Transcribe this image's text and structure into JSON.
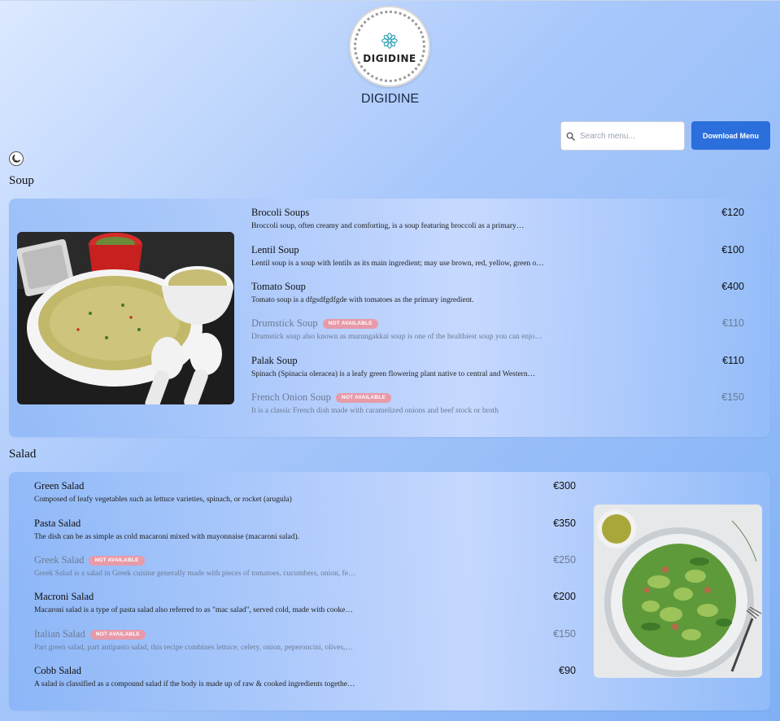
{
  "brand": {
    "name": "DIGIDINE",
    "logo_text": "DIGIDINE"
  },
  "header": {
    "search_placeholder": "Search menu...",
    "download_label": "Download Menu"
  },
  "colors": {
    "accent": "#2a6fdb",
    "badge": "#e79aa8"
  },
  "icons": {
    "search": "search-icon",
    "theme": "moon-icon",
    "logo": "lotus-icon"
  },
  "sections": [
    {
      "title": "Soup",
      "items": [
        {
          "name": "Brocoli Soups",
          "desc": "Broccoli soup, often creamy and comforting, is a soup featuring broccoli as a primary…",
          "price": "€120",
          "available": true,
          "badge": ""
        },
        {
          "name": "Lentil Soup",
          "desc": "Lentil soup is a soup with lentils as its main ingredient; may use brown, red, yellow, green o…",
          "price": "€100",
          "available": true,
          "badge": ""
        },
        {
          "name": "Tomato Soup",
          "desc": "Tomato soup is a dfgsdfgdfgde with tomatoes as the primary ingredient.",
          "price": "€400",
          "available": true,
          "badge": ""
        },
        {
          "name": "Drumstick Soup",
          "desc": "Drumstick soup also known as murungakkai soup is one of the healthiest soup you can enjo…",
          "price": "€110",
          "available": false,
          "badge": "NOT AVAILABLE"
        },
        {
          "name": "Palak Soup",
          "desc": "Spinach (Spinacia oleracea) is a leafy green flowering plant native to central and Western…",
          "price": "€110",
          "available": true,
          "badge": ""
        },
        {
          "name": "French Onion Soup",
          "desc": "It is a classic French dish made with caramelized onions and beef stock or broth",
          "price": "€150",
          "available": false,
          "badge": "NOT AVAILABLE"
        }
      ]
    },
    {
      "title": "Salad",
      "items": [
        {
          "name": "Green Salad",
          "desc": "Composed of leafy vegetables such as lettuce varieties, spinach, or rocket (arugula)",
          "price": "€300",
          "available": true,
          "badge": ""
        },
        {
          "name": "Pasta Salad",
          "desc": "The dish can be as simple as cold macaroni mixed with mayonnaise (macaroni salad).",
          "price": "€350",
          "available": true,
          "badge": ""
        },
        {
          "name": "Greek Salad",
          "desc": "Greek Salad is a salad in Greek cuisine generally made with pieces of tomatoes, cucumbers, onion, fe…",
          "price": "€250",
          "available": false,
          "badge": "NOT AVAILABLE"
        },
        {
          "name": "Macroni Salad",
          "desc": "Macaroni salad is a type of pasta salad also referred to as \"mac salad\", served cold, made with cooke…",
          "price": "€200",
          "available": true,
          "badge": ""
        },
        {
          "name": "Italian Salad",
          "desc": "Part green salad, part antipasto salad, this recipe combines lettuce, celery, onion, peperoncini, olives,…",
          "price": "€150",
          "available": false,
          "badge": "NOT AVAILABLE"
        },
        {
          "name": "Cobb Salad",
          "desc": "A salad is classified as a compound salad if the body is made up of raw & cooked ingredients togethe…",
          "price": "€90",
          "available": true,
          "badge": ""
        }
      ]
    }
  ]
}
